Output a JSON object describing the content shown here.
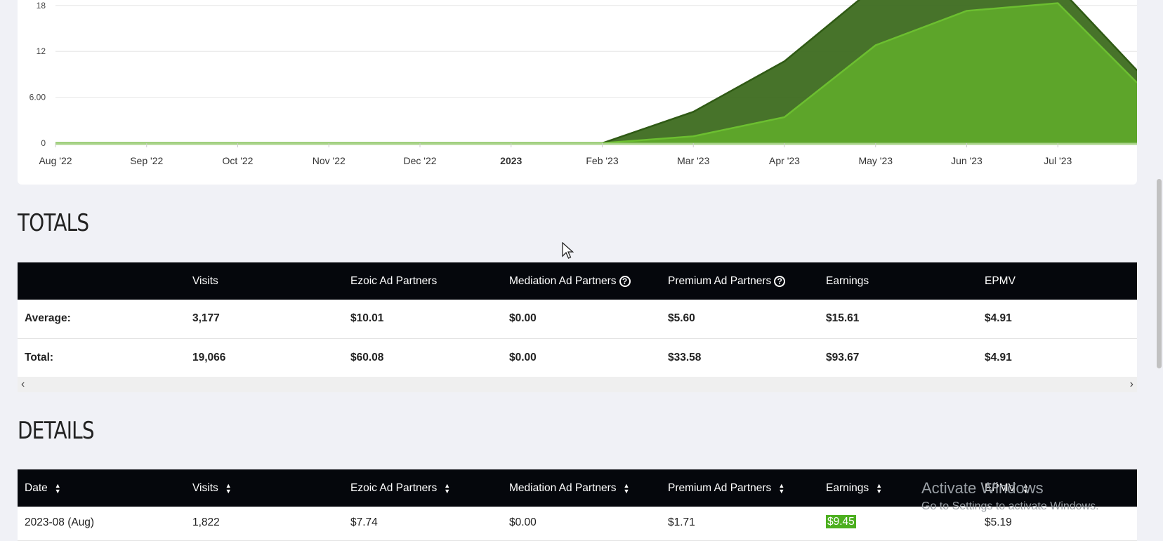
{
  "chart_data": {
    "type": "area",
    "x_ticks": [
      "Aug '22",
      "Sep '22",
      "Oct '22",
      "Nov '22",
      "Dec '22",
      "2023",
      "Feb '23",
      "Mar '23",
      "Apr '23",
      "May '23",
      "Jun '23",
      "Jul '23"
    ],
    "y_ticks": [
      "0",
      "6.00",
      "12",
      "18"
    ],
    "ylim": [
      0,
      18.5
    ],
    "series": [
      {
        "values": [
          0,
          0,
          0,
          0,
          0,
          0,
          0,
          0.9,
          3.4,
          12.8,
          17.3,
          18.3,
          7.9
        ],
        "color": "#5fa82a"
      },
      {
        "values": [
          0,
          0,
          0,
          0,
          0,
          0,
          0,
          4.1,
          10.7,
          20.5,
          21.5,
          20.5,
          9.5
        ],
        "color": "#3d6b1f"
      }
    ],
    "grid": true
  },
  "totals": {
    "title": "TOTALS",
    "columns": [
      "Visits",
      "Ezoic Ad Partners",
      "Mediation Ad Partners",
      "Premium Ad Partners",
      "Earnings",
      "EPMV"
    ],
    "rows": [
      {
        "label": "Average:",
        "values": [
          "3,177",
          "$10.01",
          "$0.00",
          "$5.60",
          "$15.61",
          "$4.91"
        ]
      },
      {
        "label": "Total:",
        "values": [
          "19,066",
          "$60.08",
          "$0.00",
          "$33.58",
          "$93.67",
          "$4.91"
        ]
      }
    ]
  },
  "details": {
    "title": "DETAILS",
    "columns": [
      "Date",
      "Visits",
      "Ezoic Ad Partners",
      "Mediation Ad Partners",
      "Premium Ad Partners",
      "Earnings",
      "EPMV"
    ],
    "rows": [
      {
        "values": [
          "2023-08 (Aug)",
          "1,822",
          "$7.74",
          "$0.00",
          "$1.71",
          "$9.45",
          "$5.19"
        ]
      }
    ]
  },
  "icons": {
    "help": "?",
    "scroll_left": "‹",
    "scroll_right": "›",
    "sort_up": "▲",
    "sort_down": "▼"
  },
  "watermark": {
    "line1": "Activate Windows",
    "line2": "Go to Settings to activate Windows."
  }
}
